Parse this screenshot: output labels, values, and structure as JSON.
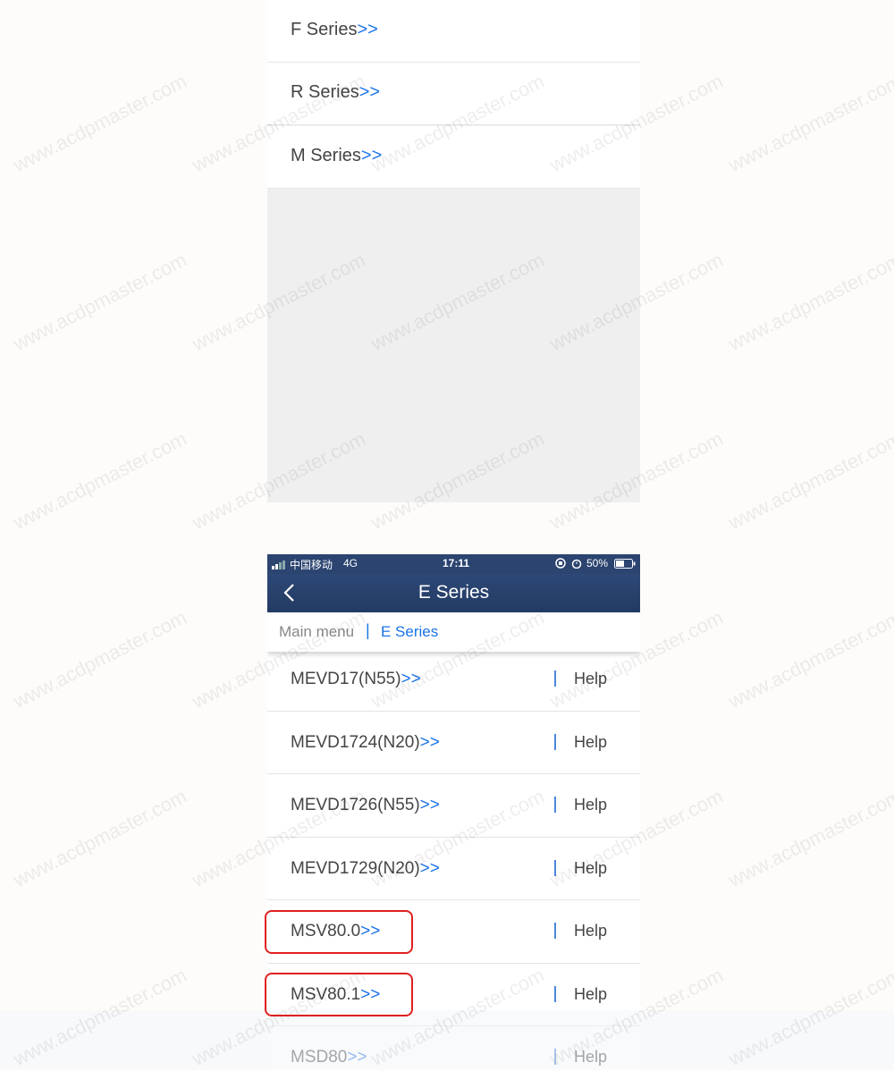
{
  "top": {
    "rows": [
      {
        "label": "F Series",
        "arrow": ">>"
      },
      {
        "label": "R Series",
        "arrow": ">>"
      },
      {
        "label": "M Series",
        "arrow": ">>"
      }
    ]
  },
  "statusbar": {
    "carrier": "中国移动",
    "network": "4G",
    "time": "17:11",
    "battery": "50%"
  },
  "navbar": {
    "title": "E Series",
    "back_icon": "chevron-left-icon"
  },
  "breadcrumb": {
    "main": "Main menu",
    "separator": "|",
    "current": "E Series"
  },
  "list": {
    "items": [
      {
        "name": "MEVD17(N55)",
        "arrow": ">>",
        "help": "Help"
      },
      {
        "name": "MEVD1724(N20)",
        "arrow": ">>",
        "help": "Help"
      },
      {
        "name": "MEVD1726(N55)",
        "arrow": ">>",
        "help": "Help"
      },
      {
        "name": "MEVD1729(N20)",
        "arrow": ">>",
        "help": "Help"
      },
      {
        "name": "MSV80.0",
        "arrow": ">>",
        "help": "Help"
      },
      {
        "name": "MSV80.1",
        "arrow": ">>",
        "help": "Help"
      },
      {
        "name": "MSD80",
        "arrow": ">>",
        "help": "Help"
      }
    ]
  },
  "watermark": "www.acdpmaster.com",
  "colors": {
    "accent": "#1a73e8",
    "navbar": "#2b4470",
    "highlight": "#e02020"
  }
}
